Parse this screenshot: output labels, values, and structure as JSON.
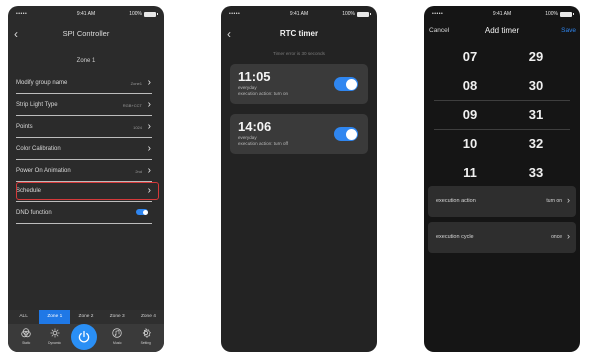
{
  "status_bar": {
    "signal": "•••••",
    "time": "9:41 AM",
    "battery": "100%"
  },
  "spi": {
    "title": "SPI Controller",
    "zone_title": "Zone 1",
    "items": [
      {
        "label": "Modify group name",
        "value": "Zone1"
      },
      {
        "label": "Strip Light Type",
        "value": "RGB+CCT"
      },
      {
        "label": "Points",
        "value": "1024"
      },
      {
        "label": "Color Calibration",
        "value": ""
      },
      {
        "label": "Power On Animation",
        "value": "2nd"
      },
      {
        "label": "Schedule",
        "value": ""
      },
      {
        "label": "DND function",
        "value": ""
      }
    ],
    "zone_tabs": [
      "ALL",
      "Zone 1",
      "Zone 2",
      "Zone 3",
      "Zone 4"
    ],
    "bottom_nav": [
      "Static",
      "Dynamic",
      "Music",
      "Setting"
    ]
  },
  "rtc": {
    "title": "RTC timer",
    "subtitle": "Timer error is 30 seconds",
    "timers": [
      {
        "time": "11:05",
        "days": "everyday",
        "action": "execution action: turn on",
        "enabled": true
      },
      {
        "time": "14:06",
        "days": "everyday",
        "action": "execution action: turn off",
        "enabled": true
      }
    ]
  },
  "add_timer": {
    "cancel": "Cancel",
    "title": "Add timer",
    "save": "Save",
    "hours": [
      "07",
      "08",
      "09",
      "10",
      "11"
    ],
    "minutes": [
      "29",
      "30",
      "31",
      "32",
      "33"
    ],
    "selected_hour": "09",
    "selected_minute": "31",
    "options": [
      {
        "label": "execution action",
        "value": "turn on"
      },
      {
        "label": "execution cycle",
        "value": "once"
      }
    ]
  },
  "colors": {
    "accent_blue": "#1f78e6",
    "highlight_red": "#d5393a"
  }
}
